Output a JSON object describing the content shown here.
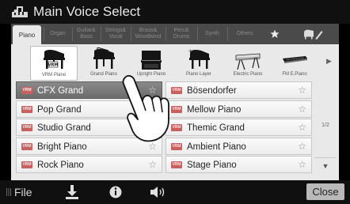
{
  "title": {
    "text": "Main Voice Select",
    "icon": "keyboard-note-icon"
  },
  "tabs": [
    {
      "label": "Piano",
      "style": "active"
    },
    {
      "label": "Organ",
      "style": "dim"
    },
    {
      "label": "Guitar&\nBass",
      "style": "dim"
    },
    {
      "label": "Strings&\nVocal",
      "style": "dim"
    },
    {
      "label": "Brass&\nWoodwind",
      "style": "dim"
    },
    {
      "label": "Perc&\nDrums",
      "style": "dim"
    },
    {
      "label": "Synth",
      "style": "dim"
    },
    {
      "label": "Others",
      "style": "dim"
    }
  ],
  "tab_icons": {
    "favorite": "star-icon",
    "user": "piano-edit-icon"
  },
  "subcategories": [
    {
      "label": "VRM Piano",
      "icon": "grand-piano-vrm-icon",
      "active": true
    },
    {
      "label": "Grand Piano",
      "icon": "grand-piano-icon"
    },
    {
      "label": "Upright Piano",
      "icon": "upright-piano-icon"
    },
    {
      "label": "Piano Layer",
      "icon": "piano-layer-icon"
    },
    {
      "label": "Electric Piano",
      "icon": "electric-piano-icon"
    },
    {
      "label": "FM E.Piano",
      "icon": "fm-epiano-icon"
    }
  ],
  "vrm_badge": "VRM",
  "voices_left": [
    {
      "name": "CFX Grand",
      "selected": true
    },
    {
      "name": "Pop Grand"
    },
    {
      "name": "Studio Grand"
    },
    {
      "name": "Bright Piano"
    },
    {
      "name": "Rock Piano"
    }
  ],
  "voices_right": [
    {
      "name": "Bösendorfer"
    },
    {
      "name": "Mellow Piano"
    },
    {
      "name": "Themic Grand"
    },
    {
      "name": "Ambient Piano"
    },
    {
      "name": "Stage Piano"
    }
  ],
  "star_glyph": "☆",
  "page_indicator": "1/2",
  "bottom": {
    "file_label": "File",
    "close_label": "Close",
    "icons": [
      "save-icon",
      "info-icon",
      "speaker-icon"
    ]
  }
}
